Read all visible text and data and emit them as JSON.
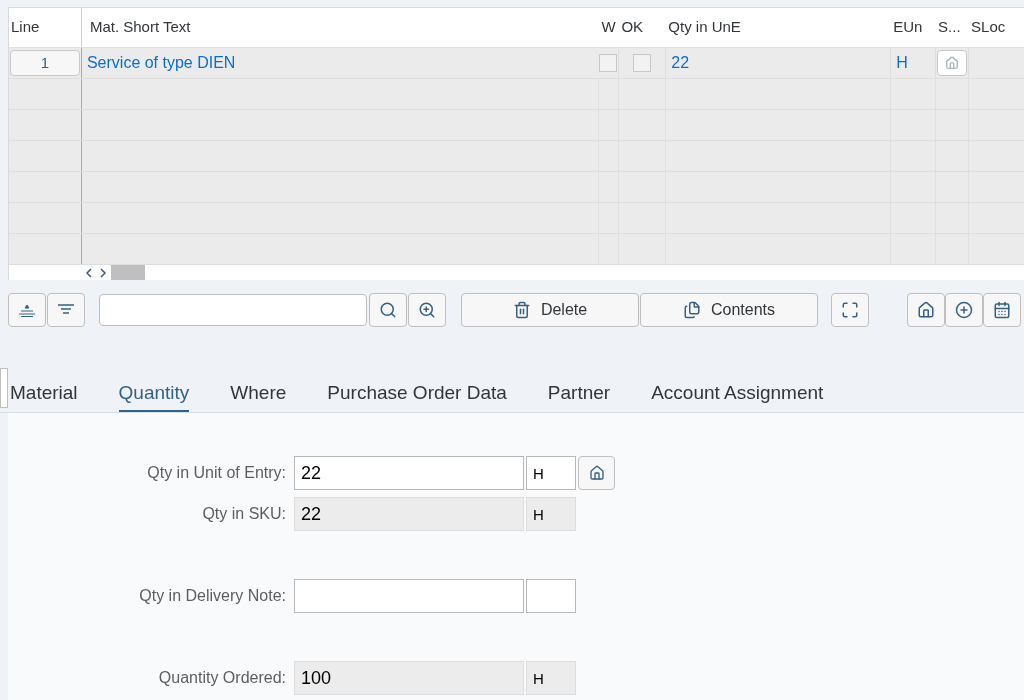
{
  "table": {
    "columns": [
      "Line",
      "Mat. Short Text",
      "W",
      "OK",
      "Qty in UnE",
      "EUn",
      "S...",
      "SLoc"
    ],
    "rows": [
      {
        "line": "1",
        "text": "Service of type DIEN",
        "w_checked": false,
        "ok_checked": false,
        "qty": "22",
        "unit": "H"
      }
    ]
  },
  "toolbar": {
    "buttons": [
      {
        "label": "Delete"
      },
      {
        "label": "Contents"
      }
    ]
  },
  "tabs": [
    {
      "label": "Material",
      "selected": false
    },
    {
      "label": "Quantity",
      "selected": true
    },
    {
      "label": "Where",
      "selected": false
    },
    {
      "label": "Purchase Order Data",
      "selected": false
    },
    {
      "label": "Partner",
      "selected": false
    },
    {
      "label": "Account Assignment",
      "selected": false
    }
  ],
  "form": [
    {
      "label": "Qty in Unit of Entry:",
      "value": "22",
      "unit": "H",
      "editable": true
    },
    {
      "label": "Qty in SKU:",
      "value": "22",
      "unit": "H",
      "editable": false
    },
    {
      "label": "Qty in Delivery Note:",
      "editable": true
    },
    {
      "label": "Quantity Ordered:",
      "value": "100",
      "unit": "H",
      "editable": false
    }
  ]
}
